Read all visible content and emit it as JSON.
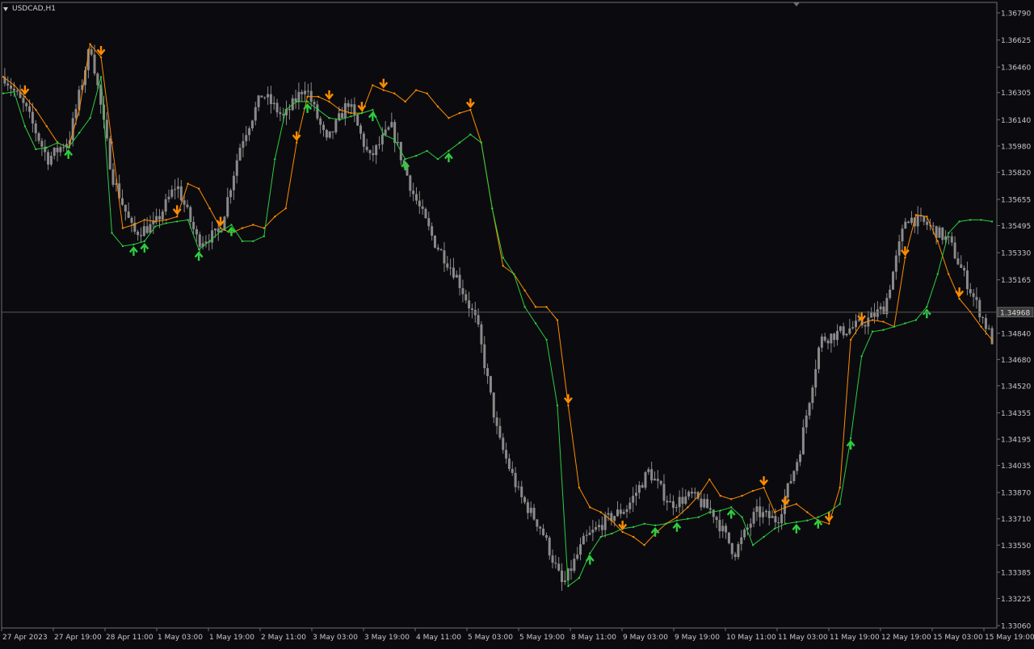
{
  "window": {
    "symbol_label": "USDCAD,H1"
  },
  "colors": {
    "background": "#0b0b0f",
    "frame": "#6f6f6f",
    "text": "#c8c8c8",
    "candle": "#8a8a8a",
    "down_line": "#ff8c00",
    "up_line": "#2ecc40",
    "price_line": "#5a5a5a",
    "price_tag_bg": "#3c3c3c",
    "price_tag_text": "#dcdcdc"
  },
  "chart_data": {
    "type": "line",
    "title": "USDCAD,H1",
    "y_axis": {
      "range": [
        1.3306,
        1.3679
      ],
      "tick_labels": [
        "1.36790",
        "1.36625",
        "1.36460",
        "1.36305",
        "1.36140",
        "1.35980",
        "1.35820",
        "1.35655",
        "1.35495",
        "1.35330",
        "1.35165",
        "1.34840",
        "1.34680",
        "1.34520",
        "1.34355",
        "1.34195",
        "1.34035",
        "1.33870",
        "1.33710",
        "1.33550",
        "1.33385",
        "1.33225",
        "1.33060"
      ]
    },
    "x_axis": {
      "tick_labels": [
        "27 Apr 2023",
        "27 Apr 19:00",
        "28 Apr 11:00",
        "1 May 03:00",
        "1 May 19:00",
        "2 May 11:00",
        "3 May 03:00",
        "3 May 19:00",
        "4 May 11:00",
        "5 May 03:00",
        "5 May 19:00",
        "8 May 11:00",
        "9 May 03:00",
        "9 May 19:00",
        "10 May 11:00",
        "11 May 03:00",
        "11 May 19:00",
        "12 May 19:00",
        "15 May 03:00",
        "15 May 19:00"
      ]
    },
    "current_price": "1.34968",
    "grid": false,
    "price_path": [
      [
        1.364,
        1.3643
      ],
      [
        1.362,
        1.3632
      ],
      [
        1.359,
        1.3595
      ],
      [
        1.3602,
        1.3598
      ],
      [
        1.366,
        1.3664
      ],
      [
        1.358,
        1.355
      ],
      [
        1.3545,
        1.3548
      ],
      [
        1.355,
        1.3553
      ],
      [
        1.3575,
        1.358
      ],
      [
        1.354,
        1.3535
      ],
      [
        1.3545,
        1.3538
      ],
      [
        1.36,
        1.361
      ],
      [
        1.363,
        1.3625
      ],
      [
        1.3615,
        1.362
      ],
      [
        1.3635,
        1.363
      ],
      [
        1.36,
        1.3605
      ],
      [
        1.3625,
        1.3628
      ],
      [
        1.359,
        1.3592
      ],
      [
        1.361,
        1.36
      ],
      [
        1.357,
        1.356
      ],
      [
        1.354,
        1.3535
      ],
      [
        1.352,
        1.3515
      ],
      [
        1.349,
        1.3485
      ],
      [
        1.342,
        1.34
      ],
      [
        1.3385,
        1.3378
      ],
      [
        1.3365,
        1.3355
      ],
      [
        1.333,
        1.3335
      ],
      [
        1.3358,
        1.3362
      ],
      [
        1.337,
        1.3372
      ],
      [
        1.3378,
        1.3383
      ],
      [
        1.34,
        1.3395
      ],
      [
        1.338,
        1.3385
      ],
      [
        1.3385,
        1.339
      ],
      [
        1.3375,
        1.3368
      ],
      [
        1.335,
        1.337
      ],
      [
        1.3375,
        1.3372
      ],
      [
        1.337,
        1.339
      ],
      [
        1.341,
        1.343
      ],
      [
        1.348,
        1.349
      ],
      [
        1.3485,
        1.3492
      ],
      [
        1.349,
        1.3488
      ],
      [
        1.35,
        1.352
      ],
      [
        1.3555,
        1.356
      ],
      [
        1.355,
        1.3552
      ],
      [
        1.354,
        1.352
      ],
      [
        1.351,
        1.349
      ],
      [
        1.348,
        1.3465
      ]
    ],
    "series": [
      {
        "color": "#ff8c00",
        "values": [
          1.364,
          1.3635,
          1.3628,
          1.362,
          1.361,
          1.36,
          1.3597,
          1.362,
          1.366,
          1.3652,
          1.36,
          1.3548,
          1.355,
          1.3553,
          1.3552,
          1.3553,
          1.3555,
          1.3575,
          1.3572,
          1.356,
          1.3548,
          1.3545,
          1.3548,
          1.355,
          1.3548,
          1.3555,
          1.356,
          1.36,
          1.3628,
          1.3628,
          1.3625,
          1.362,
          1.3618,
          1.3618,
          1.3635,
          1.3632,
          1.363,
          1.3625,
          1.3632,
          1.363,
          1.3622,
          1.3615,
          1.3618,
          1.362,
          1.36,
          1.356,
          1.3525,
          1.352,
          1.351,
          1.35,
          1.35,
          1.3492,
          1.344,
          1.339,
          1.3378,
          1.3375,
          1.337,
          1.3363,
          1.336,
          1.3355,
          1.3362,
          1.3368,
          1.3372,
          1.3378,
          1.3385,
          1.3395,
          1.3385,
          1.3383,
          1.3385,
          1.3388,
          1.339,
          1.3375,
          1.3378,
          1.338,
          1.3375,
          1.337,
          1.3368,
          1.339,
          1.348,
          1.349,
          1.3492,
          1.3491,
          1.3488,
          1.353,
          1.3556,
          1.3555,
          1.354,
          1.352,
          1.3505,
          1.3497,
          1.3488,
          1.348
        ]
      },
      {
        "color": "#2ecc40",
        "values": [
          1.363,
          1.3631,
          1.361,
          1.3596,
          1.3597,
          1.36,
          1.3597,
          1.3606,
          1.3615,
          1.364,
          1.3545,
          1.3537,
          1.3538,
          1.354,
          1.3549,
          1.3551,
          1.3552,
          1.3553,
          1.3535,
          1.354,
          1.3546,
          1.355,
          1.354,
          1.354,
          1.3543,
          1.359,
          1.362,
          1.3625,
          1.3625,
          1.362,
          1.3615,
          1.3614,
          1.3616,
          1.3618,
          1.362,
          1.3605,
          1.3602,
          1.359,
          1.3592,
          1.3595,
          1.359,
          1.3595,
          1.36,
          1.3605,
          1.36,
          1.356,
          1.353,
          1.352,
          1.35,
          1.349,
          1.348,
          1.344,
          1.333,
          1.3335,
          1.335,
          1.336,
          1.3362,
          1.3365,
          1.3366,
          1.3368,
          1.3367,
          1.3368,
          1.337,
          1.3371,
          1.3372,
          1.3375,
          1.3376,
          1.3378,
          1.3372,
          1.3355,
          1.336,
          1.3365,
          1.3368,
          1.3369,
          1.337,
          1.3372,
          1.3375,
          1.338,
          1.342,
          1.347,
          1.3485,
          1.3486,
          1.3488,
          1.349,
          1.3492,
          1.35,
          1.352,
          1.3545,
          1.3552,
          1.3553,
          1.3553,
          1.3552
        ]
      }
    ],
    "down_arrow_marks": [
      2,
      9,
      16,
      20,
      27,
      30,
      33,
      35,
      43,
      52,
      57,
      70,
      72,
      76,
      79,
      83,
      88
    ],
    "up_arrow_marks": [
      6,
      12,
      13,
      18,
      21,
      28,
      34,
      37,
      41,
      54,
      60,
      62,
      67,
      73,
      75,
      78,
      85
    ]
  }
}
